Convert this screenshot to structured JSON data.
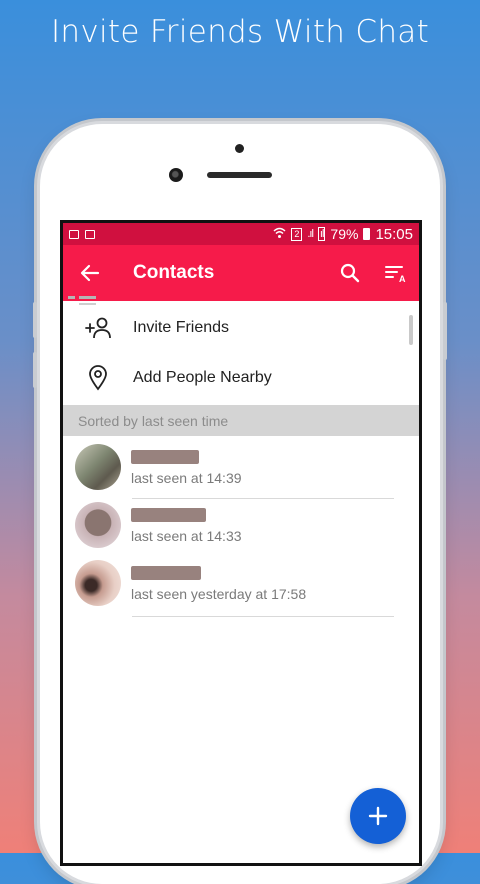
{
  "promo": {
    "title": "Invite Friends With Chat"
  },
  "status_bar": {
    "signal_text": "2",
    "battery": "79%",
    "time": "15:05"
  },
  "app_bar": {
    "title": "Contacts"
  },
  "actions": [
    {
      "label": "Invite Friends",
      "icon": "add-person-icon"
    },
    {
      "label": "Add People Nearby",
      "icon": "location-pin-icon"
    }
  ],
  "section_header": "Sorted by last seen time",
  "contacts": [
    {
      "status": "last seen at 14:39",
      "avatar_color": "#8a8f7d"
    },
    {
      "status": "last seen at 14:33",
      "avatar_color": "#9b8077"
    },
    {
      "status": "last seen yesterday at 17:58",
      "avatar_color": "#b79a8c"
    }
  ],
  "colors": {
    "status_bar": "#d0103f",
    "app_bar": "#f61b4a",
    "fab": "#1460d6",
    "section_header_bg": "#d4d4d4"
  }
}
